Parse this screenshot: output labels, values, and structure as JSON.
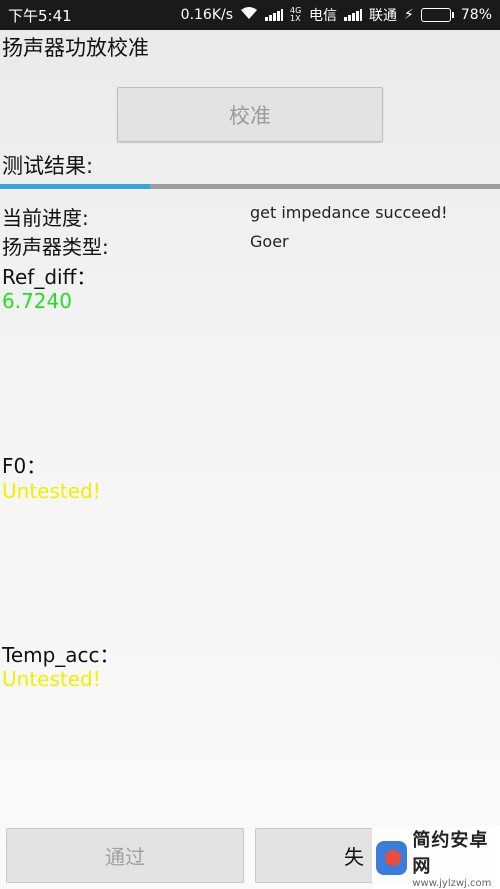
{
  "status_bar": {
    "time": "下午5:41",
    "net_speed": "0.16K/s",
    "carrier1_tech": "4G 1X",
    "carrier1": "电信",
    "carrier2": "联通",
    "battery": "78%",
    "battery_level": 0.78,
    "icons": [
      "wifi-icon",
      "signal-icon",
      "charging-icon",
      "battery-icon"
    ]
  },
  "page": {
    "title": "扬声器功放校准",
    "calibrate_button": "校准",
    "test_result_label": "测试结果:",
    "progress": 0.3
  },
  "results": {
    "progress_label": "当前进度:",
    "progress_value": "get impedance succeed!",
    "speaker_type_label": "扬声器类型:",
    "speaker_type_value": "Goer",
    "ref_diff_label": "Ref_diff：",
    "ref_diff_value": "6.7240",
    "f0_label": "F0：",
    "f0_value": "Untested!",
    "temp_acc_label": "Temp_acc：",
    "temp_acc_value": "Untested!"
  },
  "bottom": {
    "pass_button": "通过",
    "fail_button": "失"
  },
  "watermark": {
    "name": "简约安卓网",
    "url": "www.jylzwj.com"
  },
  "colors": {
    "accent": "#33a8e0",
    "pass_value": "#22e022",
    "untested": "#f0f000"
  }
}
